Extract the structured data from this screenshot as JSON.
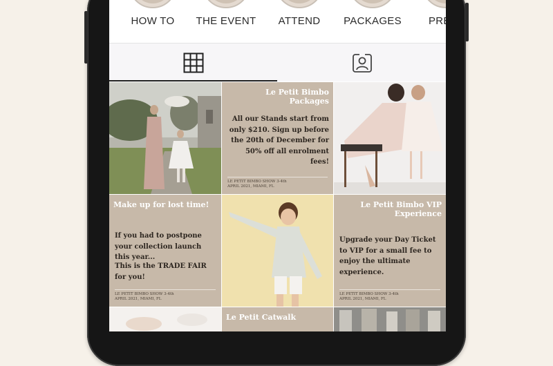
{
  "highlights": [
    {
      "label": "HOW TO"
    },
    {
      "label": "THE EVENT"
    },
    {
      "label": "ATTEND"
    },
    {
      "label": "PACKAGES"
    },
    {
      "label": "PRE"
    }
  ],
  "tabs": [
    {
      "name": "grid",
      "icon": "grid-icon",
      "active": true
    },
    {
      "name": "tagged",
      "icon": "tagged-person-icon",
      "active": false
    }
  ],
  "posts": {
    "packages": {
      "title": "Le Petit Bimbo Packages",
      "body": "All our Stands start from only $210. Sign up before the 20th of December for 50% off all enrolment fees!",
      "footer_line1": "LE PETIT BIMBO SHOW 3-4th",
      "footer_line2": "APRIL 2021, MIAMI, FL"
    },
    "makeup": {
      "title": "Make up for lost time!",
      "body1": "If you had to postpone your collection launch this year...",
      "body2": "This is the TRADE FAIR for you!",
      "footer_line1": "LE PETIT BIMBO SHOW 3-4th",
      "footer_line2": "APRIL 2021, MIAMI, FL"
    },
    "vip": {
      "title": "Le Petit Bimbo VIP Experience",
      "body": "Upgrade your Day Ticket to VIP for a small fee to enjoy the ultimate experience.",
      "footer_line1": "LE PETIT BIMBO SHOW 3-4th",
      "footer_line2": "APRIL 2021, MIAMI, FL"
    },
    "catwalk": {
      "title": "Le Petit Catwalk"
    }
  },
  "colors": {
    "tile_beige": "#c7b9a9",
    "tile_text_dark": "#2d2620",
    "highlight_ring": "#c9c0b6",
    "page_bg": "#f6f1e9"
  }
}
